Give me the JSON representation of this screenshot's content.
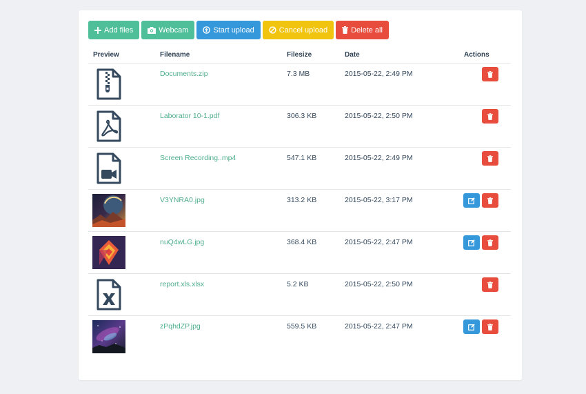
{
  "toolbar": {
    "add_files": "Add files",
    "webcam": "Webcam",
    "start_upload": "Start upload",
    "cancel_upload": "Cancel upload",
    "delete_all": "Delete all"
  },
  "table": {
    "headers": {
      "preview": "Preview",
      "filename": "Filename",
      "filesize": "Filesize",
      "date": "Date",
      "actions": "Actions"
    },
    "rows": [
      {
        "preview": "zip-file-icon",
        "filename": "Documents.zip",
        "filesize": "7.3 MB",
        "date": "2015-05-22, 2:49 PM",
        "editable": false
      },
      {
        "preview": "pdf-file-icon",
        "filename": "Laborator 10-1.pdf",
        "filesize": "306.3 KB",
        "date": "2015-05-22, 2:50 PM",
        "editable": false
      },
      {
        "preview": "video-file-icon",
        "filename": "Screen Recording..mp4",
        "filesize": "547.1 KB",
        "date": "2015-05-22, 2:49 PM",
        "editable": false
      },
      {
        "preview": "image-thumbnail-planet",
        "filename": "V3YNRA0.jpg",
        "filesize": "313.2 KB",
        "date": "2015-05-22, 3:17 PM",
        "editable": true
      },
      {
        "preview": "image-thumbnail-geometric",
        "filename": "nuQ4wLG.jpg",
        "filesize": "368.4 KB",
        "date": "2015-05-22, 2:47 PM",
        "editable": true
      },
      {
        "preview": "excel-file-icon",
        "filename": "report.xls.xlsx",
        "filesize": "5.2 KB",
        "date": "2015-05-22, 2:50 PM",
        "editable": false
      },
      {
        "preview": "image-thumbnail-galaxy",
        "filename": "zPqhdZP.jpg",
        "filesize": "559.5 KB",
        "date": "2015-05-22, 2:47 PM",
        "editable": true
      }
    ]
  },
  "colors": {
    "green": "#4fbf99",
    "blue": "#3498db",
    "yellow": "#f1c40f",
    "red": "#e74c3c",
    "link": "#4fae8c",
    "text": "#34495e"
  }
}
